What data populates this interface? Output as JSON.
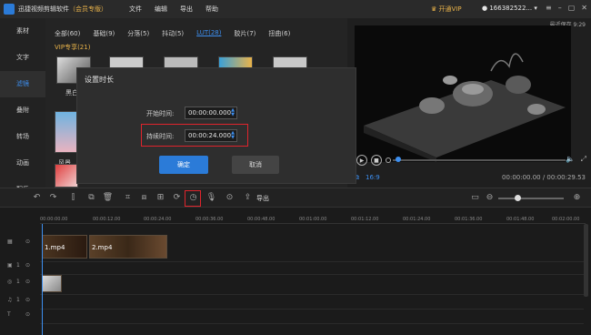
{
  "app": {
    "title": "迅捷视频剪辑软件",
    "edition": "（会员专版）",
    "menu": [
      "文件",
      "编辑",
      "导出",
      "帮助"
    ],
    "vip_label": "开通VIP",
    "user_id": "166382522...",
    "autosave": "最近保存 9:29"
  },
  "sidenav": [
    "素材",
    "文字",
    "滤镜",
    "叠附",
    "转场",
    "动画",
    "配乐"
  ],
  "library": {
    "tabs": [
      "全部(60)",
      "基础(9)",
      "分落(5)",
      "抖动(5)",
      "LUT(28)",
      "胶片(7)",
      "扭曲(6)"
    ],
    "sub_label": "VIP专享(21)",
    "thumb_labels": [
      "黑白1",
      "风景"
    ]
  },
  "dialog": {
    "title": "设置时长",
    "start_label": "开始时间:",
    "start_value": "00:00:00.000",
    "duration_label": "持续时间:",
    "duration_value": "00:00:24.000",
    "ok": "确定",
    "cancel": "取消"
  },
  "preview": {
    "ratio": "16:9",
    "time": "00:00:00.00 / 00:00:29.53"
  },
  "toolbar": {
    "export": "导出"
  },
  "timeline": {
    "ticks": [
      "00:00:00.00",
      "00:00:12.00",
      "00:00:24.00",
      "00:00:36.00",
      "00:00:48.00",
      "00:01:00.00",
      "00:01:12.00",
      "00:01:24.00",
      "00:01:36.00",
      "00:01:48.00",
      "00:02:00.00"
    ],
    "clips": [
      "1.mp4",
      "2.mp4"
    ],
    "track_numbers": [
      "1",
      "1",
      "1"
    ]
  },
  "colors": {
    "accent": "#3d8ff0",
    "vip": "#e9b34a",
    "highlight": "#e0242c"
  }
}
